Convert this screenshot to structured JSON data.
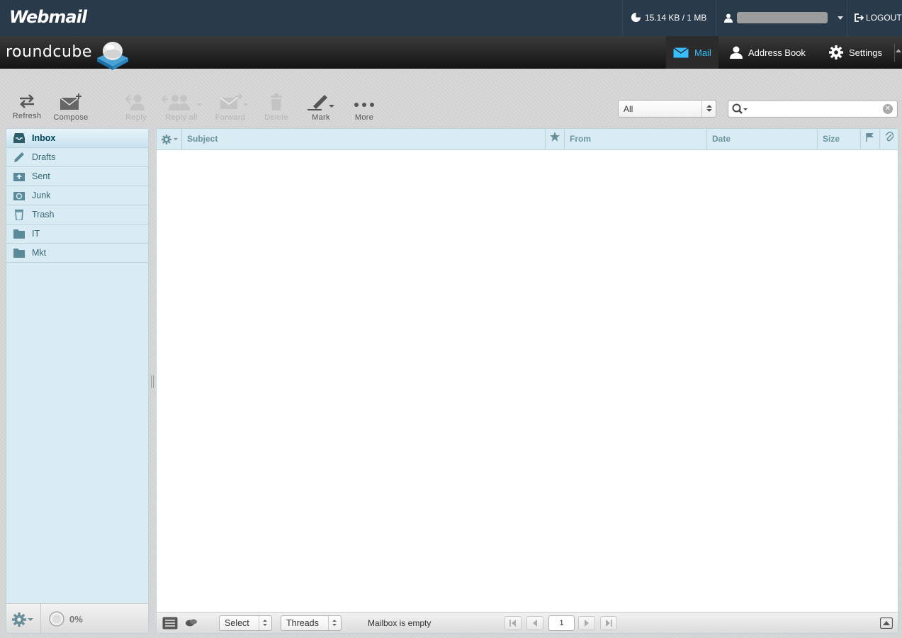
{
  "cpanel": {
    "brand": "Webmail",
    "quota": "15.14 KB / 1 MB",
    "logout": "LOGOUT"
  },
  "header": {
    "logo_text": "roundcube",
    "nav": [
      {
        "label": "Mail",
        "active": true
      },
      {
        "label": "Address Book",
        "active": false
      },
      {
        "label": "Settings",
        "active": false
      }
    ]
  },
  "toolbar": {
    "refresh": "Refresh",
    "compose": "Compose",
    "reply": "Reply",
    "reply_all": "Reply all",
    "forward": "Forward",
    "delete": "Delete",
    "mark": "Mark",
    "more": "More"
  },
  "filter": {
    "selected": "All"
  },
  "search": {
    "value": ""
  },
  "folders": [
    {
      "label": "Inbox",
      "icon": "inbox-icon",
      "selected": true
    },
    {
      "label": "Drafts",
      "icon": "pencil-icon"
    },
    {
      "label": "Sent",
      "icon": "sent-icon"
    },
    {
      "label": "Junk",
      "icon": "junk-icon"
    },
    {
      "label": "Trash",
      "icon": "trash-icon"
    },
    {
      "label": "IT",
      "icon": "folder-icon"
    },
    {
      "label": "Mkt",
      "icon": "folder-icon"
    }
  ],
  "folder_quota": "0%",
  "message_list": {
    "columns": {
      "subject": "Subject",
      "from": "From",
      "date": "Date",
      "size": "Size"
    },
    "select_label": "Select",
    "threads_label": "Threads",
    "status": "Mailbox is empty",
    "page": "1"
  },
  "colors": {
    "cpanel_bar": "#293a4a",
    "accent": "#37beff",
    "panel_bg": "#d9ecf4"
  }
}
